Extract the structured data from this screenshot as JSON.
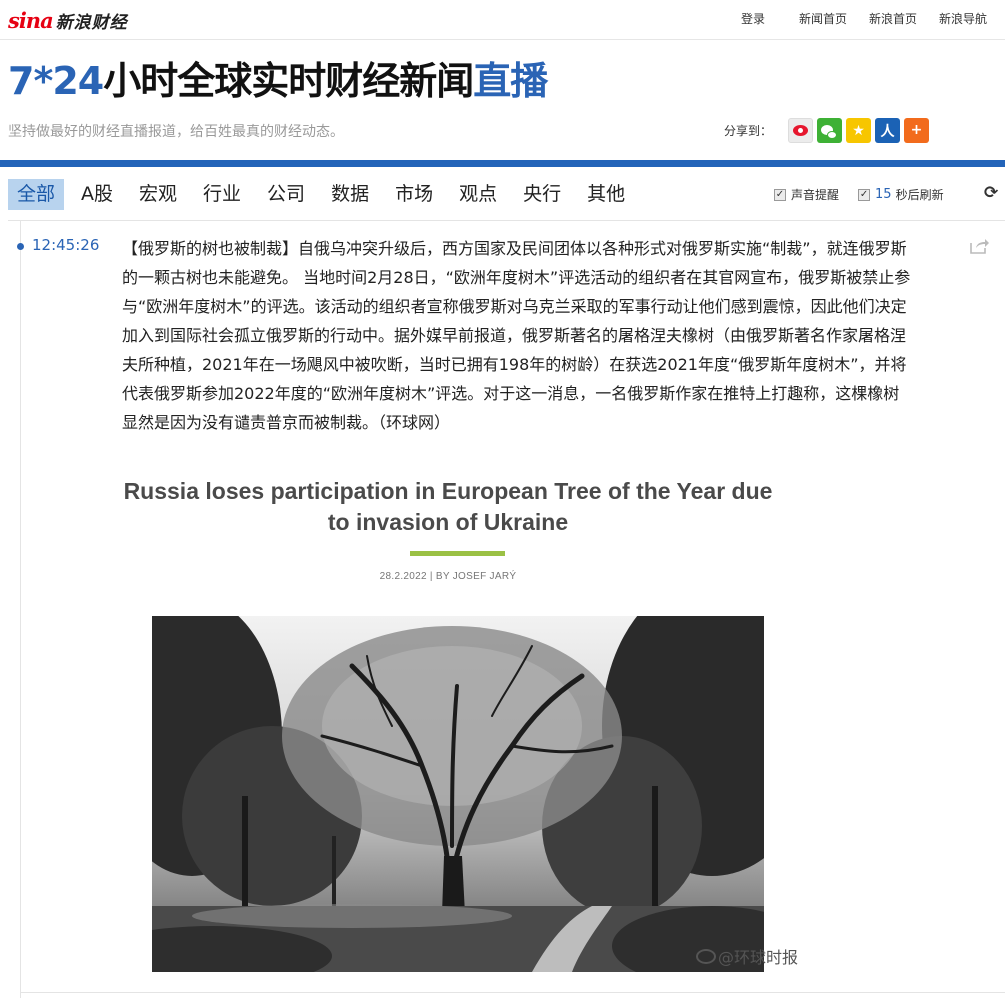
{
  "topbar": {
    "logo_brand": "sina",
    "logo_suffix": "新浪财经",
    "links": {
      "login": "登录",
      "news_home": "新闻首页",
      "sina_home": "新浪首页",
      "sina_nav": "新浪导航"
    }
  },
  "headline": {
    "part1": "7*24",
    "part2": "小时全球实时财经新闻",
    "part3": "直播"
  },
  "subtitle": "坚持做最好的财经直播报道，给百姓最真的财经动态。",
  "share": {
    "label": "分享到：",
    "icons": [
      "weibo-icon",
      "wechat-icon",
      "qzone-icon",
      "people-icon",
      "more-share-icon"
    ]
  },
  "nav": {
    "tabs": [
      "全部",
      "A股",
      "宏观",
      "行业",
      "公司",
      "数据",
      "市场",
      "观点",
      "央行",
      "其他"
    ],
    "active_index": 0,
    "sound_label": "声音提醒",
    "sound_checked": true,
    "refresh_checked": true,
    "refresh_seconds": "15",
    "refresh_label": "秒后刷新"
  },
  "news_item": {
    "time": "12:45:26",
    "text": "【俄罗斯的树也被制裁】自俄乌冲突升级后，西方国家及民间团体以各种形式对俄罗斯实施“制裁”，就连俄罗斯的一颗古树也未能避免。 当地时间2月28日，“欧洲年度树木”评选活动的组织者在其官网宣布，俄罗斯被禁止参与“欧洲年度树木”的评选。该活动的组织者宣称俄罗斯对乌克兰采取的军事行动让他们感到震惊，因此他们决定加入到国际社会孤立俄罗斯的行动中。据外媒早前报道，俄罗斯著名的屠格涅夫橡树（由俄罗斯著名作家屠格涅夫所种植，2021年在一场飓风中被吹断，当时已拥有198年的树龄）在获选2021年度“俄罗斯年度树木”，并将代表俄罗斯参加2022年度的“欧洲年度树木”评选。对于这一消息，一名俄罗斯作家在推特上打趣称，这棵橡树显然是因为没有谴责普京而被制裁。（环球网）",
    "image": {
      "title": "Russia loses participation in European Tree of the Year due to invasion of Ukraine",
      "meta": "28.2.2022 | BY JOSEF JARÝ",
      "watermark": "@环球时报",
      "accent_color": "#9bc145"
    }
  },
  "colors": {
    "brand_blue": "#2364b9",
    "tab_active_bg": "#b8d3ee",
    "sina_red": "#e60012"
  }
}
